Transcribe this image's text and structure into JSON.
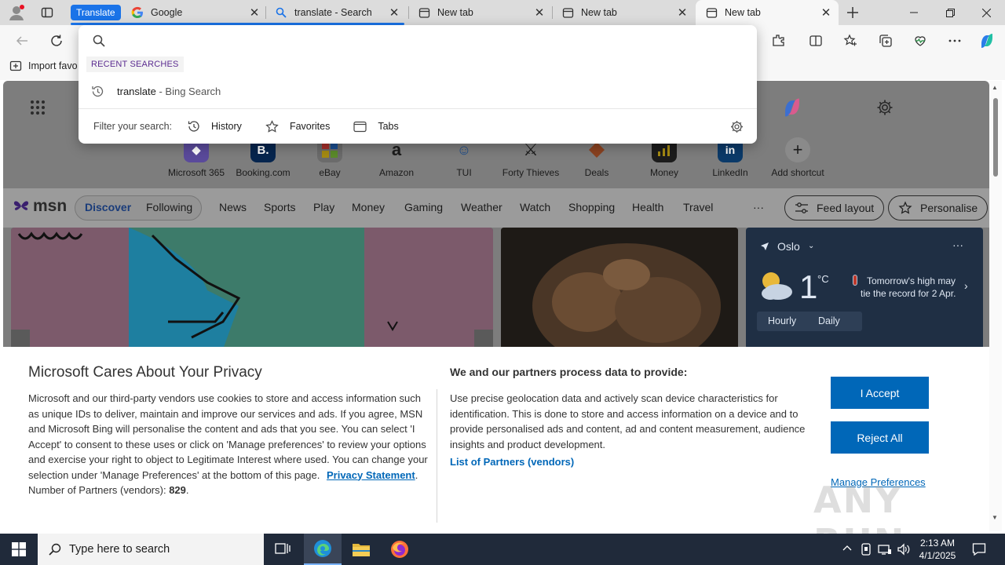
{
  "tabs": {
    "group_label": "Translate",
    "items": [
      {
        "label": "Google",
        "icon": "google-icon"
      },
      {
        "label": "translate - Search",
        "icon": "search-icon"
      },
      {
        "label": "New tab",
        "icon": "newtab-icon"
      },
      {
        "label": "New tab",
        "icon": "newtab-icon"
      },
      {
        "label": "New tab",
        "icon": "newtab-icon"
      }
    ]
  },
  "favorites_bar": {
    "import_label": "Import favo"
  },
  "omnibox": {
    "recent_heading": "RECENT SEARCHES",
    "suggestion_term": "translate",
    "suggestion_source": " - Bing Search",
    "filter_label": "Filter your search:",
    "filters": [
      "History",
      "Favorites",
      "Tabs"
    ]
  },
  "shortcuts": [
    {
      "label": "Microsoft 365",
      "color": "#6b4fbb"
    },
    {
      "label": "Booking.com",
      "color": "#003580"
    },
    {
      "label": "eBay",
      "color": "#e53238"
    },
    {
      "label": "Amazon",
      "color": "#ffffff"
    },
    {
      "label": "TUI",
      "color": "#d6e9f8"
    },
    {
      "label": "Forty Thieves",
      "color": "#ffffff"
    },
    {
      "label": "Deals",
      "color": "#d9682b"
    },
    {
      "label": "Money",
      "color": "#1c1c1c"
    },
    {
      "label": "LinkedIn",
      "color": "#0a66c2"
    },
    {
      "label": "Add shortcut",
      "color": "#ffffff"
    }
  ],
  "msn": {
    "logo": "msn",
    "tabs": [
      "Discover",
      "Following"
    ],
    "nav": [
      "News",
      "Sports",
      "Play",
      "Money",
      "Gaming",
      "Weather",
      "Watch",
      "Shopping",
      "Health",
      "Travel"
    ],
    "more": "···",
    "feed_layout": "Feed layout",
    "personalise": "Personalise"
  },
  "weather": {
    "city": "Oslo",
    "temp": "1",
    "unit": "°C",
    "note_line1": "Tomorrow's high may",
    "note_line2": "tie the record for 2 Apr.",
    "tabs": [
      "Hourly",
      "Daily"
    ]
  },
  "privacy": {
    "title": "Microsoft Cares About Your Privacy",
    "body": "Microsoft and our third-party vendors use cookies to store and access information such as unique IDs to deliver, maintain and improve our services and ads. If you agree, MSN and Microsoft Bing will personalise the content and ads that you see. You can select 'I Accept' to consent to these uses or click on 'Manage preferences' to review your options and exercise your right to object to Legitimate Interest where used.  You can change your selection under 'Manage Preferences' at the bottom of this page.",
    "privacy_link": "Privacy Statement",
    "partners_label": "Number of Partners (vendors): ",
    "partners_count": "829",
    "right_title": "We and our partners process data to provide:",
    "right_body": "Use precise geolocation data and actively scan device characteristics for identification. This is done to store and access information on a device and to provide personalised ads and content, ad and content measurement, audience insights and product development.",
    "partners_link": "List of Partners (vendors)",
    "accept": "I Accept",
    "reject": "Reject All",
    "manage": "Manage Preferences"
  },
  "watermark": "ANY RUN",
  "taskbar": {
    "search_placeholder": "Type here to search",
    "time": "2:13 AM",
    "date": "4/1/2025"
  },
  "colors": {
    "accent": "#0067b8",
    "tab_group": "#1a73e8",
    "taskbar": "#202a3a"
  }
}
